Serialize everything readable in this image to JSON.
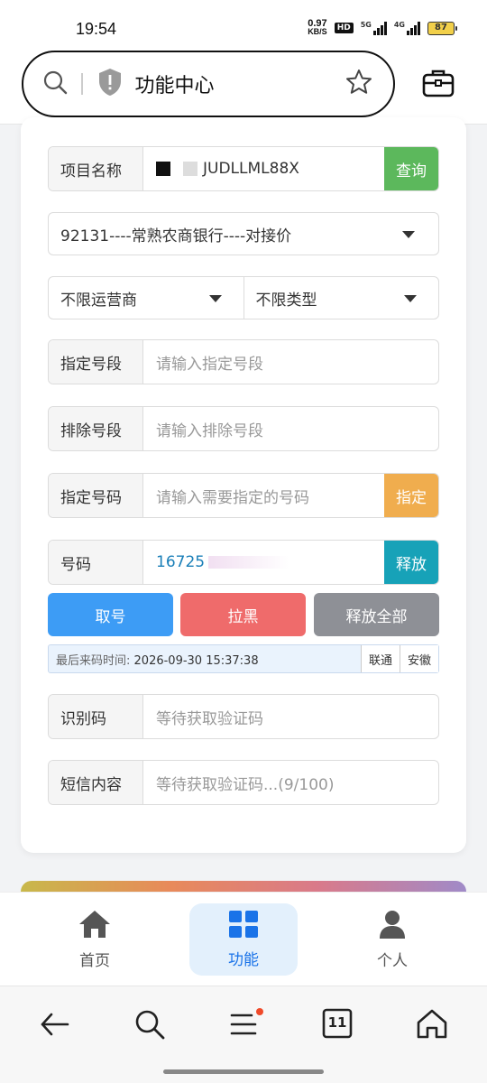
{
  "status": {
    "time": "19:54",
    "net_speed": "0.97",
    "net_unit": "KB/S",
    "hd": "HD",
    "sig1_label": "5G",
    "sig2_label": "4G",
    "battery": "87"
  },
  "browser": {
    "title": "功能中心",
    "icons": [
      "search-icon",
      "shield-icon",
      "star-icon",
      "toolbox-icon"
    ]
  },
  "form": {
    "project": {
      "label": "项目名称",
      "value": "JUDLLML88X",
      "button": "查询"
    },
    "channel": {
      "value": "92131----常熟农商银行----对接价"
    },
    "carrier": {
      "value": "不限运营商"
    },
    "type": {
      "value": "不限类型"
    },
    "segment": {
      "label": "指定号段",
      "placeholder": "请输入指定号段"
    },
    "exclude": {
      "label": "排除号段",
      "placeholder": "请输入排除号段"
    },
    "specify": {
      "label": "指定号码",
      "placeholder": "请输入需要指定的号码",
      "button": "指定"
    },
    "number": {
      "label": "号码",
      "value": "16725",
      "button": "释放"
    },
    "actions": {
      "get": "取号",
      "block": "拉黑",
      "release_all": "释放全部"
    },
    "info": {
      "key": "最后来码时间:",
      "time": "2026-09-30 15:37:38",
      "carrier_tag": "联通",
      "region_tag": "安徽"
    },
    "code": {
      "label": "识别码",
      "placeholder": "等待获取验证码"
    },
    "sms": {
      "label": "短信内容",
      "placeholder": "等待获取验证码...(9/100)"
    }
  },
  "colors": {
    "query": "#5cb85c",
    "specify": "#f0ad4e",
    "release": "#17a2b8",
    "get": "#3d9cf5",
    "block": "#ef6b6b",
    "release_all": "#8e9096",
    "active_nav": "#1a73e8"
  },
  "nav": [
    {
      "label": "首页",
      "icon": "home-icon"
    },
    {
      "label": "功能",
      "icon": "grid-icon",
      "active": true
    },
    {
      "label": "个人",
      "icon": "person-icon"
    }
  ],
  "browser_bottom": {
    "tabs_count": "11",
    "icons": [
      "back-icon",
      "search-icon",
      "menu-icon",
      "tabs-icon",
      "home-icon"
    ]
  }
}
